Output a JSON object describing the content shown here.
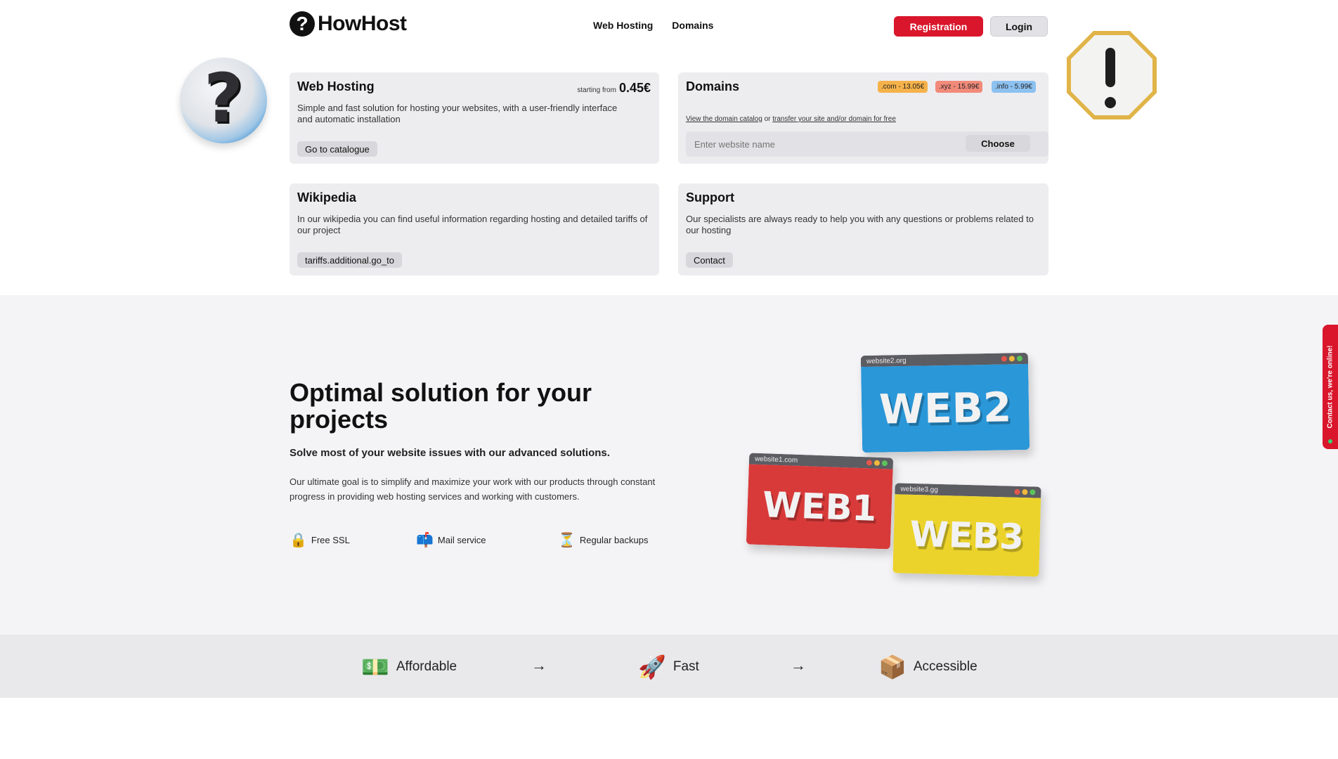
{
  "header": {
    "logo_text": "HowHost",
    "logo_mark": "?",
    "nav": [
      "Web Hosting",
      "Domains"
    ],
    "registration": "Registration",
    "login": "Login"
  },
  "cards": {
    "hosting": {
      "title": "Web Hosting",
      "price_prefix": "starting from",
      "price": "0.45€",
      "desc": "Simple and fast solution for hosting your websites, with a user-friendly interface and automatic installation",
      "button": "Go to catalogue"
    },
    "domains": {
      "title": "Domains",
      "tlds": [
        ".com - 13.05€",
        ".xyz - 15.99€",
        ".info - 5.99€"
      ],
      "link1": "View the domain catalog",
      "or": "or",
      "link2": "transfer your site and/or domain for free",
      "placeholder": "Enter website name",
      "choose": "Choose"
    },
    "wiki": {
      "title": "Wikipedia",
      "desc": "In our wikipedia you can find useful information regarding hosting and detailed tariffs of our project",
      "button": "tariffs.additional.go_to"
    },
    "support": {
      "title": "Support",
      "desc": "Our specialists are always ready to help you with any questions or problems related to our hosting",
      "button": "Contact"
    }
  },
  "hero": {
    "title": "Optimal solution for your projects",
    "subtitle": "Solve most of your website issues with our advanced solutions.",
    "text": "Our ultimate goal is to simplify and maximize your work with our products through constant progress in providing web hosting services and working with customers.",
    "features": [
      {
        "icon": "lock-icon",
        "glyph": "🔒",
        "label": "Free SSL"
      },
      {
        "icon": "mailbox-icon",
        "glyph": "📫",
        "label": "Mail service"
      },
      {
        "icon": "hourglass-icon",
        "glyph": "⏳",
        "label": "Regular backups"
      }
    ]
  },
  "windows": [
    {
      "url": "website2.org",
      "label": "WEB2",
      "color": "#2a97d8"
    },
    {
      "url": "website1.com",
      "label": "WEB1",
      "color": "#d83a3a"
    },
    {
      "url": "website3.gg",
      "label": "WEB3",
      "color": "#ebd32b"
    }
  ],
  "bottom": [
    {
      "icon": "money-icon",
      "glyph": "💵",
      "label": "Affordable"
    },
    {
      "icon": "rocket-icon",
      "glyph": "🚀",
      "label": "Fast"
    },
    {
      "icon": "box-icon",
      "glyph": "📦",
      "label": "Accessible"
    }
  ],
  "arrow": "→",
  "contact_tab": "Contact us, we're online!",
  "colors": {
    "accent": "#d9162b",
    "tld_com": "#f6b24a",
    "tld_xyz": "#f28a7a",
    "tld_info": "#8cc1f0"
  }
}
